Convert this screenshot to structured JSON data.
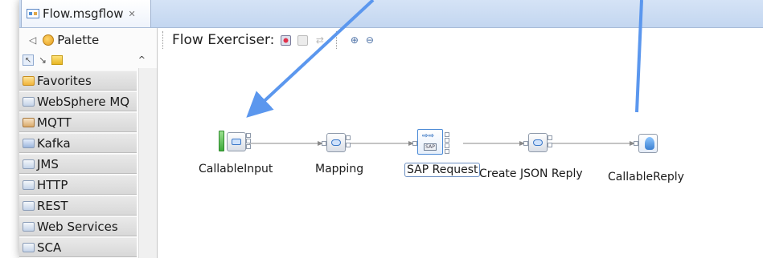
{
  "tab": {
    "title": "Flow.msgflow",
    "close_glyph": "✕"
  },
  "palette": {
    "title": "Palette",
    "back_glyph": "◁",
    "scroll_up_glyph": "^",
    "tool_icons": [
      "selection-tool-icon",
      "connection-tool-icon",
      "marquee-tool-icon"
    ],
    "drawers": [
      {
        "label": "Favorites",
        "icon": "favorites-icon"
      },
      {
        "label": "WebSphere MQ",
        "icon": "websphere-mq-icon"
      },
      {
        "label": "MQTT",
        "icon": "mqtt-icon"
      },
      {
        "label": "Kafka",
        "icon": "kafka-icon"
      },
      {
        "label": "JMS",
        "icon": "jms-icon"
      },
      {
        "label": "HTTP",
        "icon": "http-icon"
      },
      {
        "label": "REST",
        "icon": "rest-icon"
      },
      {
        "label": "Web Services",
        "icon": "web-services-icon"
      },
      {
        "label": "SCA",
        "icon": "sca-icon"
      }
    ]
  },
  "toolbar": {
    "flow_exerciser_label": "Flow Exerciser:",
    "zoom_in_glyph": "⊕",
    "zoom_out_glyph": "⊖"
  },
  "flow": {
    "nodes": [
      {
        "id": "callable-input",
        "label": "CallableInput"
      },
      {
        "id": "mapping",
        "label": "Mapping"
      },
      {
        "id": "sap-request",
        "label": "SAP Request",
        "selected": true,
        "badge": "SAP"
      },
      {
        "id": "create-json-reply",
        "label": "Create JSON Reply"
      },
      {
        "id": "callable-reply",
        "label": "CallableReply"
      }
    ]
  },
  "colors": {
    "annotation_arrow": "#5b97ee",
    "tabbar": "#c9daf2",
    "selection": "#4b8ad6"
  }
}
